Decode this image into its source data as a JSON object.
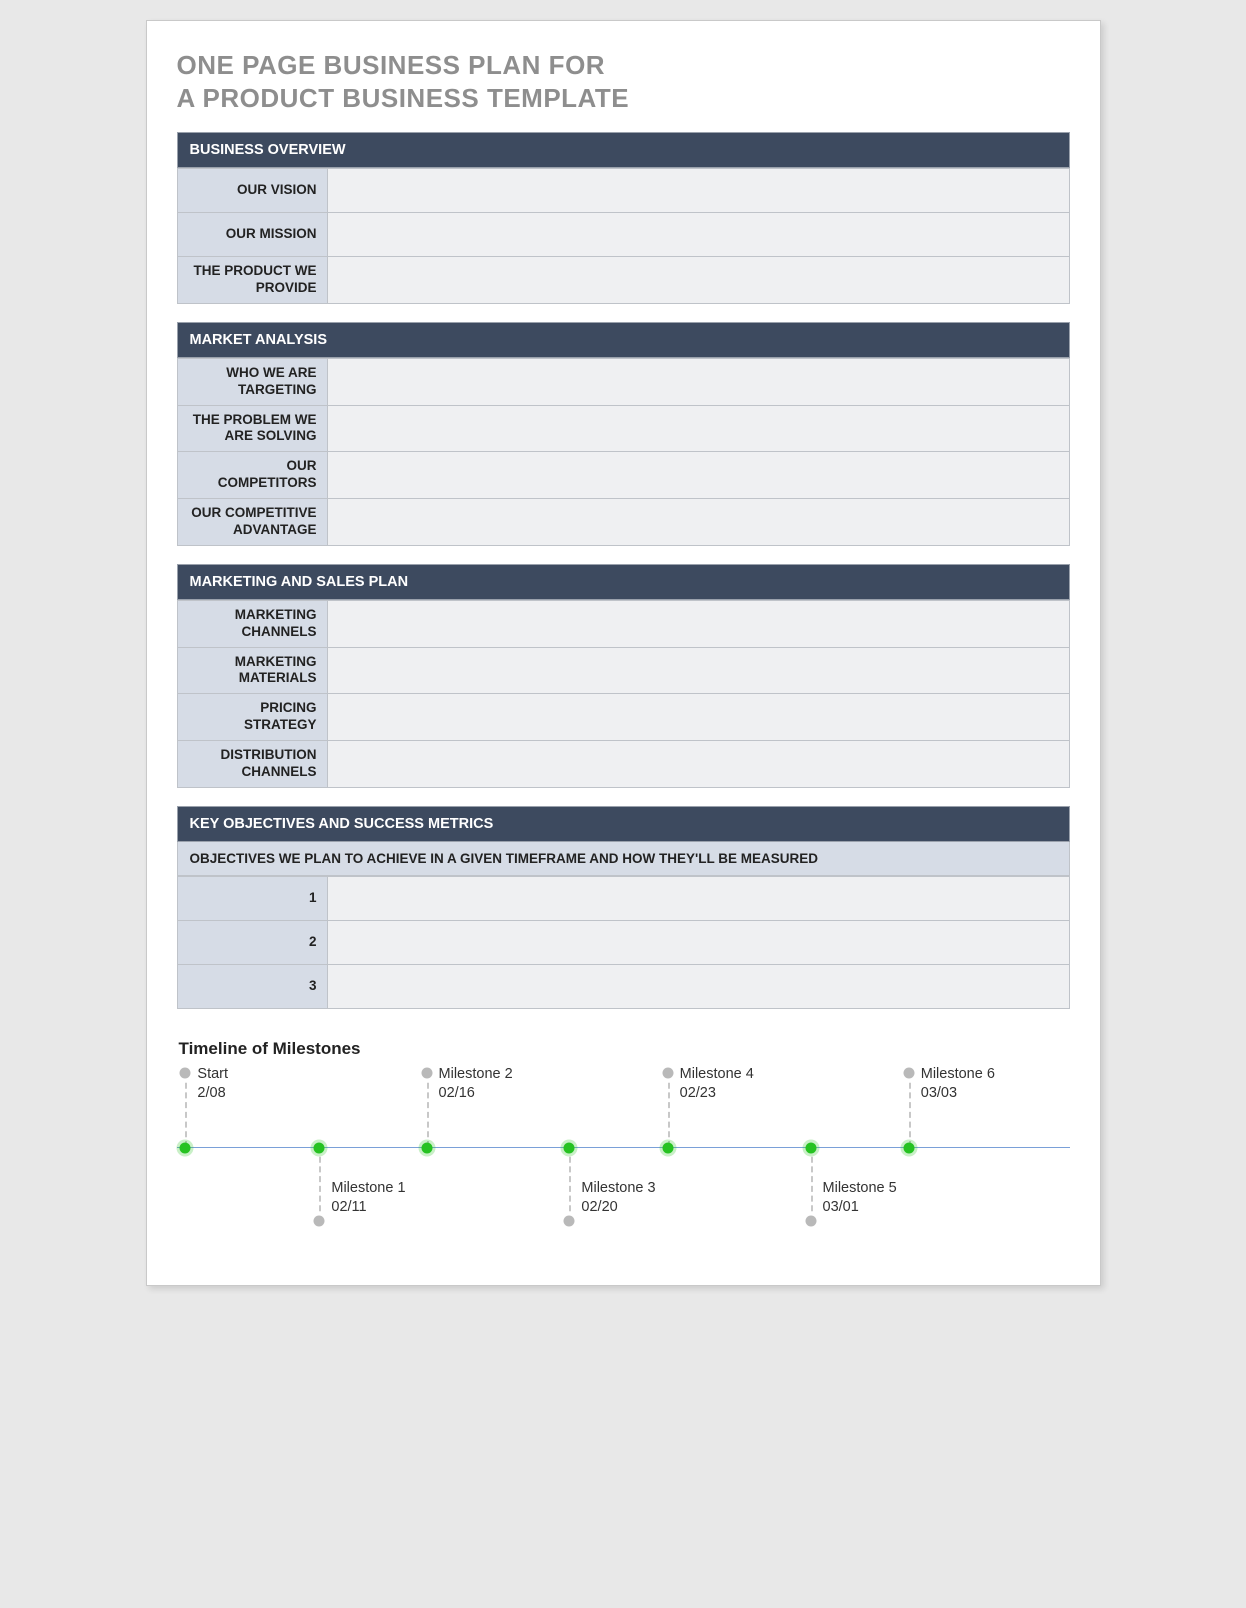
{
  "title_line1": "ONE PAGE BUSINESS PLAN FOR",
  "title_line2": "A PRODUCT BUSINESS TEMPLATE",
  "sections": {
    "overview": {
      "header": "BUSINESS OVERVIEW",
      "rows": [
        {
          "label": "OUR VISION",
          "value": ""
        },
        {
          "label": "OUR MISSION",
          "value": ""
        },
        {
          "label": "THE PRODUCT WE PROVIDE",
          "value": ""
        }
      ]
    },
    "market": {
      "header": "MARKET ANALYSIS",
      "rows": [
        {
          "label": "WHO WE ARE TARGETING",
          "value": ""
        },
        {
          "label": "THE PROBLEM WE ARE SOLVING",
          "value": ""
        },
        {
          "label": "OUR COMPETITORS",
          "value": ""
        },
        {
          "label": "OUR COMPETITIVE ADVANTAGE",
          "value": ""
        }
      ]
    },
    "marketing": {
      "header": "MARKETING AND SALES PLAN",
      "rows": [
        {
          "label": "MARKETING CHANNELS",
          "value": ""
        },
        {
          "label": "MARKETING MATERIALS",
          "value": ""
        },
        {
          "label": "PRICING STRATEGY",
          "value": ""
        },
        {
          "label": "DISTRIBUTION CHANNELS",
          "value": ""
        }
      ]
    },
    "objectives": {
      "header": "KEY OBJECTIVES AND SUCCESS METRICS",
      "subheader": "OBJECTIVES WE PLAN TO ACHIEVE IN A GIVEN TIMEFRAME AND HOW THEY'LL BE MEASURED",
      "rows": [
        {
          "label": "1",
          "value": ""
        },
        {
          "label": "2",
          "value": ""
        },
        {
          "label": "3",
          "value": ""
        }
      ]
    }
  },
  "timeline": {
    "title": "Timeline of Milestones",
    "milestones": [
      {
        "name": "Start",
        "date": "2/08",
        "pos": 1,
        "side": "top"
      },
      {
        "name": "Milestone 1",
        "date": "02/11",
        "pos": 16,
        "side": "bot"
      },
      {
        "name": "Milestone 2",
        "date": "02/16",
        "pos": 28,
        "side": "top"
      },
      {
        "name": "Milestone 3",
        "date": "02/20",
        "pos": 44,
        "side": "bot"
      },
      {
        "name": "Milestone 4",
        "date": "02/23",
        "pos": 55,
        "side": "top"
      },
      {
        "name": "Milestone 5",
        "date": "03/01",
        "pos": 71,
        "side": "bot"
      },
      {
        "name": "Milestone 6",
        "date": "03/03",
        "pos": 82,
        "side": "top"
      }
    ]
  }
}
